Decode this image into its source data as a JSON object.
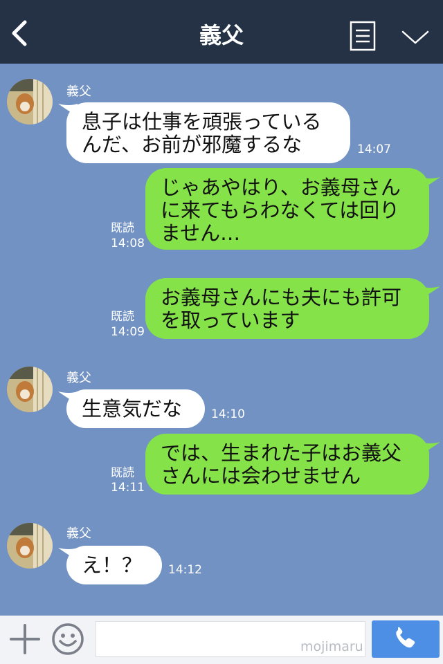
{
  "header": {
    "title": "義父",
    "back_icon": "chevron-left-icon",
    "menu_icon": "note-icon",
    "dropdown_icon": "chevron-down-icon"
  },
  "messages": [
    {
      "sender": "義父",
      "lines": [
        "息子は仕事を頑張っている",
        "んだ、お前が邪魔するな"
      ],
      "time": "14:07"
    },
    {
      "lines": [
        "じゃあやはり、お義母さん",
        "に来てもらわなくては回り",
        "ません…"
      ],
      "read": "既読",
      "time": "14:08"
    },
    {
      "lines": [
        "お義母さんにも夫にも許可",
        "を取っています"
      ],
      "read": "既読",
      "time": "14:09"
    },
    {
      "sender": "義父",
      "lines": [
        "生意気だな"
      ],
      "time": "14:10"
    },
    {
      "lines": [
        "では、生まれた子はお義父",
        "さんには会わせません"
      ],
      "read": "既読",
      "time": "14:11"
    },
    {
      "sender": "義父",
      "lines": [
        "え！？"
      ],
      "time": "14:12"
    }
  ],
  "footer": {
    "plus_icon": "plus-icon",
    "emoji_icon": "smiley-icon",
    "input_value": "",
    "watermark": "mojimaru",
    "call_icon": "phone-icon"
  },
  "colors": {
    "header_bg": "#253246",
    "chat_bg": "#7192c2",
    "incoming_bubble": "#ffffff",
    "outgoing_bubble": "#85e249",
    "call_button": "#4c8fe4"
  }
}
